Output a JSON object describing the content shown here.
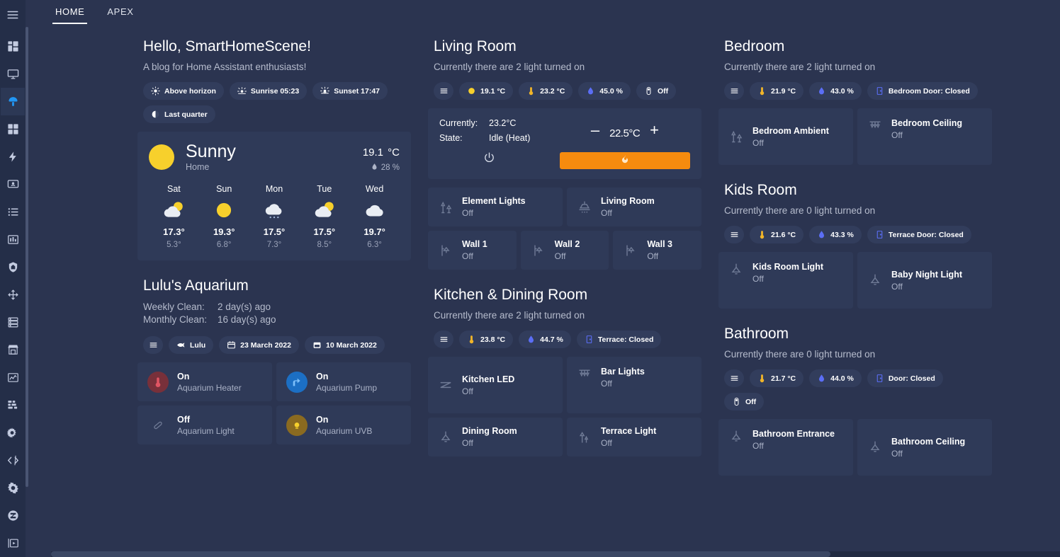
{
  "sidebar": {
    "menu_label": "menu",
    "items": [
      {
        "name": "overview",
        "icon": "grid-icon",
        "active": false
      },
      {
        "name": "media-browser",
        "icon": "monitor-icon",
        "active": false
      },
      {
        "name": "mushroom",
        "icon": "mushroom-icon",
        "active": true
      },
      {
        "name": "dashboard",
        "icon": "grid2-icon",
        "active": false
      },
      {
        "name": "energy",
        "icon": "lightning-icon",
        "active": false
      },
      {
        "name": "person",
        "icon": "person-card-icon",
        "active": false
      },
      {
        "name": "todo",
        "icon": "list-icon",
        "active": false
      },
      {
        "name": "history",
        "icon": "bar-chart-icon",
        "active": false
      },
      {
        "name": "security",
        "icon": "shield-home-icon",
        "active": false
      },
      {
        "name": "automation",
        "icon": "arrows-icon",
        "active": false
      },
      {
        "name": "server",
        "icon": "server-icon",
        "active": false
      },
      {
        "name": "store",
        "icon": "store-icon",
        "active": false
      },
      {
        "name": "statistics",
        "icon": "line-chart-icon",
        "active": false
      },
      {
        "name": "network",
        "icon": "network-icon",
        "active": false
      },
      {
        "name": "integrations",
        "icon": "cogs-icon",
        "active": false
      },
      {
        "name": "code-editor",
        "icon": "code-icon",
        "active": false
      },
      {
        "name": "settings",
        "icon": "gear-icon",
        "active": false
      },
      {
        "name": "zigbee",
        "icon": "circle-slash-icon",
        "active": false
      },
      {
        "name": "media-player",
        "icon": "media-play-icon",
        "active": false
      }
    ]
  },
  "topbar": {
    "tabs": [
      {
        "label": "HOME",
        "active": true
      },
      {
        "label": "APEX",
        "active": false
      }
    ]
  },
  "greeting": {
    "title": "Hello, SmartHomeScene!",
    "subtitle": "A blog for Home Assistant enthusiasts!",
    "chips": [
      {
        "icon": "sun-above-icon",
        "label": "Above horizon"
      },
      {
        "icon": "sunrise-icon",
        "label": "Sunrise 05:23"
      },
      {
        "icon": "sunset-icon",
        "label": "Sunset 17:47"
      },
      {
        "icon": "moon-icon",
        "label": "Last quarter"
      }
    ]
  },
  "weather": {
    "condition": "Sunny",
    "location": "Home",
    "temperature": "19.1",
    "temperature_unit": "°C",
    "humidity": "28 %",
    "forecast": [
      {
        "day": "Sat",
        "icon": "partly-cloudy-icon",
        "high": "17.3°",
        "low": "5.3°"
      },
      {
        "day": "Sun",
        "icon": "sunny-icon",
        "high": "19.3°",
        "low": "6.8°"
      },
      {
        "day": "Mon",
        "icon": "rainy-icon",
        "high": "17.5°",
        "low": "7.3°"
      },
      {
        "day": "Tue",
        "icon": "partly-cloudy-icon",
        "high": "17.5°",
        "low": "8.5°"
      },
      {
        "day": "Wed",
        "icon": "cloudy-icon",
        "high": "19.7°",
        "low": "6.3°"
      }
    ]
  },
  "aquarium": {
    "title": "Lulu's Aquarium",
    "weekly_label": "Weekly Clean:",
    "weekly_value": "2 day(s) ago",
    "monthly_label": "Monthly Clean:",
    "monthly_value": "16 day(s) ago",
    "chips": [
      {
        "icon": "hamburger-icon",
        "label": ""
      },
      {
        "icon": "fish-icon",
        "label": "Lulu"
      },
      {
        "icon": "calendar-icon",
        "label": "23 March 2022"
      },
      {
        "icon": "calendar2-icon",
        "label": "10 March 2022"
      }
    ],
    "devices": [
      {
        "state": "On",
        "name": "Aquarium Heater",
        "icon": "thermometer-icon",
        "circle": "red"
      },
      {
        "state": "On",
        "name": "Aquarium Pump",
        "icon": "pump-icon",
        "circle": "blue"
      },
      {
        "state": "Off",
        "name": "Aquarium Light",
        "icon": "tube-light-icon",
        "circle": "plain"
      },
      {
        "state": "On",
        "name": "Aquarium UVB",
        "icon": "uvb-icon",
        "circle": "amber"
      }
    ]
  },
  "living_room": {
    "title": "Living Room",
    "subtitle": "Currently there are 2 light turned on",
    "chips": [
      {
        "icon": "hamburger-icon",
        "label": ""
      },
      {
        "icon": "sun-yellow-icon",
        "label": "19.1 °C"
      },
      {
        "icon": "thermometer-icon",
        "label": "23.2 °C"
      },
      {
        "icon": "humidity-icon",
        "label": "45.0 %"
      },
      {
        "icon": "motion-icon",
        "label": "Off"
      }
    ],
    "thermostat": {
      "currently_label": "Currently:",
      "currently_value": "23.2°C",
      "state_label": "State:",
      "state_value": "Idle (Heat)",
      "minus": "–",
      "plus": "+",
      "setpoint": "22.5",
      "setpoint_unit": "°C",
      "mode_icon": "flame-icon",
      "power_icon": "power-icon",
      "accent": "#f68b0e"
    },
    "lights": [
      {
        "name": "Element Lights",
        "state": "Off",
        "icon": "floor-lamp-icon"
      },
      {
        "name": "Living Room",
        "state": "Off",
        "icon": "ceiling-light-icon"
      },
      {
        "name": "Wall 1",
        "state": "Off",
        "icon": "wall-sconce-icon"
      },
      {
        "name": "Wall 2",
        "state": "Off",
        "icon": "wall-sconce-icon"
      },
      {
        "name": "Wall 3",
        "state": "Off",
        "icon": "wall-sconce-icon"
      }
    ]
  },
  "kitchen": {
    "title": "Kitchen & Dining Room",
    "subtitle": "Currently there are 2 light turned on",
    "chips": [
      {
        "icon": "hamburger-icon",
        "label": ""
      },
      {
        "icon": "thermometer-icon",
        "label": "23.8 °C"
      },
      {
        "icon": "humidity-icon",
        "label": "44.7 %"
      },
      {
        "icon": "door-icon",
        "label": "Terrace: Closed"
      }
    ],
    "lights": [
      {
        "name": "Kitchen LED",
        "state": "Off",
        "icon": "led-strip-icon"
      },
      {
        "name": "Bar Lights",
        "state": "Off",
        "icon": "bar-lights-icon"
      },
      {
        "name": "Dining Room",
        "state": "Off",
        "icon": "pendant-light-icon"
      },
      {
        "name": "Terrace Light",
        "state": "Off",
        "icon": "outdoor-light-icon"
      }
    ]
  },
  "bedroom": {
    "title": "Bedroom",
    "subtitle": "Currently there are 2 light turned on",
    "chips": [
      {
        "icon": "hamburger-icon",
        "label": ""
      },
      {
        "icon": "thermometer-icon",
        "label": "21.9 °C"
      },
      {
        "icon": "humidity-icon",
        "label": "43.0 %"
      },
      {
        "icon": "door-icon",
        "label": "Bedroom Door: Closed"
      }
    ],
    "lights": [
      {
        "name": "Bedroom Ambient",
        "state": "Off",
        "icon": "floor-lamp-icon"
      },
      {
        "name": "Bedroom Ceiling",
        "state": "Off",
        "icon": "bar-lights-icon"
      }
    ]
  },
  "kids_room": {
    "title": "Kids Room",
    "subtitle": "Currently there are 0 light turned on",
    "chips": [
      {
        "icon": "hamburger-icon",
        "label": ""
      },
      {
        "icon": "thermometer-icon",
        "label": "21.6 °C"
      },
      {
        "icon": "humidity-icon",
        "label": "43.3 %"
      },
      {
        "icon": "door-icon",
        "label": "Terrace Door: Closed"
      }
    ],
    "lights": [
      {
        "name": "Kids Room Light",
        "state": "Off",
        "icon": "pendant-light-icon"
      },
      {
        "name": "Baby Night Light",
        "state": "Off",
        "icon": "pendant-light-icon"
      }
    ]
  },
  "bathroom": {
    "title": "Bathroom",
    "subtitle": "Currently there are 0 light turned on",
    "chips": [
      {
        "icon": "hamburger-icon",
        "label": ""
      },
      {
        "icon": "thermometer-icon",
        "label": "21.7 °C"
      },
      {
        "icon": "humidity-icon",
        "label": "44.0 %"
      },
      {
        "icon": "door-icon",
        "label": "Door: Closed"
      },
      {
        "icon": "motion-icon",
        "label": "Off"
      }
    ],
    "lights": [
      {
        "name": "Bathroom Entrance",
        "state": "Off",
        "icon": "pendant-light-icon"
      },
      {
        "name": "Bathroom Ceiling",
        "state": "Off",
        "icon": "pendant-light-icon"
      }
    ]
  },
  "colors": {
    "page_bg": "#2b3450",
    "card_bg": "#2f3a58",
    "chip_bg": "#323d5c",
    "sidebar_bg": "#242e48",
    "accent_blue": "#2196f3",
    "accent_orange": "#f68b0e",
    "sun_yellow": "#f7d02c"
  }
}
